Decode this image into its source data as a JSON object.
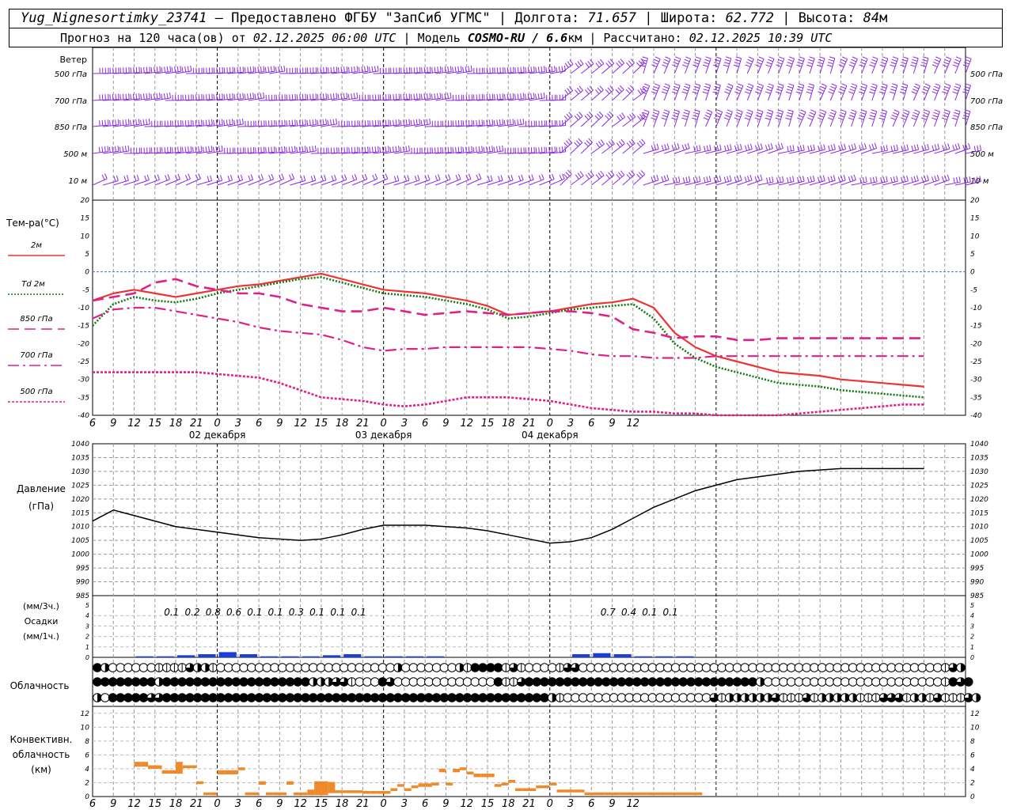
{
  "header": {
    "station": "Yug_Nignesortimky_23741",
    "provider": "Предоставлено ФГБУ \"ЗапСиб УГМС\"",
    "lon_label": "Долгота:",
    "lon_value": "71.657",
    "lat_label": "Широта:",
    "lat_value": "62.772",
    "alt_label": "Высота:",
    "alt_value": "84",
    "alt_unit": "м",
    "forecast_prefix": "Прогноз на 120 часа(ов) от",
    "forecast_from": "02.12.2025 06:00 UTC",
    "model_label": "Модель",
    "model_name": "COSMO-RU / 6.6",
    "model_unit": "км",
    "calc_label": "Рассчитано:",
    "calc_time": "02.12.2025 10:39 UTC"
  },
  "colors": {
    "wind": "#8a2be2",
    "t2m": "#ee3333",
    "td2m": "#117711",
    "t_upper": "#e0208a",
    "pressure": "#000000",
    "precip": "#1a3fd8",
    "convective": "#ee8a2a",
    "zero_line": "#4a6ad8"
  },
  "chart_data": [
    {
      "type": "wind-barbs",
      "name": "wind",
      "title": "Ветер",
      "levels": [
        "500 гПа",
        "700 гПа",
        "850 гПа",
        "500 м",
        "10  м"
      ]
    },
    {
      "type": "line",
      "name": "temperature",
      "ylabel": "Тем-ра(°C)",
      "ylim": [
        -40,
        20
      ],
      "yticks": [
        20,
        15,
        10,
        5,
        0,
        -5,
        -10,
        -15,
        -20,
        -25,
        -30,
        -35,
        -40
      ],
      "x": [
        0,
        3,
        6,
        9,
        12,
        15,
        18,
        21,
        24,
        27,
        30,
        33,
        36,
        39,
        42,
        45,
        48,
        51,
        54,
        57,
        60,
        63,
        66,
        69,
        72,
        75,
        78,
        81,
        84,
        87,
        90,
        93,
        96,
        99,
        102,
        105,
        108,
        111,
        114,
        117,
        120
      ],
      "series": [
        {
          "name": "2м",
          "key": "t2m",
          "values": [
            -8,
            -6,
            -5,
            -6,
            -7,
            -6,
            -5,
            -4,
            -3.5,
            -2.5,
            -1.5,
            -0.5,
            -2,
            -3.5,
            -5,
            -5.5,
            -6,
            -7,
            -8,
            -9.5,
            -12,
            -11.5,
            -11,
            -10,
            -9,
            -8.5,
            -7.5,
            -10,
            -17,
            -21,
            -23.5,
            -25,
            -26.5,
            -28,
            -28.5,
            -29,
            -30,
            -30.5,
            -31,
            -31.5,
            -32
          ]
        },
        {
          "name": "Td  2м",
          "key": "td2m",
          "values": [
            -15,
            -9,
            -7,
            -8,
            -8.5,
            -7.5,
            -6,
            -5,
            -4,
            -3,
            -2,
            -1.5,
            -3,
            -4.5,
            -6,
            -6.5,
            -7,
            -8,
            -9,
            -10.5,
            -13,
            -12.5,
            -11.5,
            -10.5,
            -10,
            -9.5,
            -9,
            -13,
            -20,
            -24,
            -26.5,
            -28,
            -29.5,
            -31,
            -31.5,
            -32,
            -33,
            -33.5,
            -34,
            -34.5,
            -35
          ]
        },
        {
          "name": "850 гПа",
          "key": "t850",
          "values": [
            -8,
            -7,
            -6,
            -3,
            -2,
            -4,
            -5,
            -6,
            -6,
            -7,
            -9,
            -10,
            -11,
            -11,
            -10,
            -11,
            -12,
            -11.5,
            -11,
            -11.5,
            -12,
            -11.5,
            -11,
            -11,
            -11.5,
            -12.5,
            -16,
            -17,
            -18.5,
            -18,
            -18,
            -19,
            -19,
            -18.5,
            -18.5,
            -18.5,
            -18.5,
            -18.5,
            -18.5,
            -18.5,
            -18.5
          ]
        },
        {
          "name": "700 гПа",
          "key": "t700",
          "values": [
            -13,
            -10.5,
            -10,
            -10,
            -11,
            -12,
            -13,
            -14,
            -15.5,
            -16.5,
            -17,
            -17.5,
            -19,
            -21,
            -22,
            -21.5,
            -21.5,
            -21,
            -21,
            -21,
            -21,
            -21,
            -21.5,
            -22,
            -23,
            -23.5,
            -23.5,
            -24,
            -24,
            -24,
            -23.5,
            -23.5,
            -23.5,
            -23.5,
            -23.5,
            -23.5,
            -23.5,
            -23.5,
            -23.5,
            -23.5,
            -23.5
          ]
        },
        {
          "name": "500 гПа",
          "key": "t500",
          "values": [
            -28,
            -28,
            -28,
            -28,
            -28,
            -28,
            -28.5,
            -29,
            -29.5,
            -31,
            -33,
            -35,
            -35.5,
            -36,
            -37,
            -37.5,
            -37,
            -36,
            -35,
            -35,
            -35,
            -35.5,
            -36,
            -37,
            -38,
            -38.5,
            -39,
            -39,
            -39.5,
            -39.5,
            -40,
            -40,
            -40,
            -40,
            -39.5,
            -39,
            -38.5,
            -38,
            -37.5,
            -37,
            -37
          ]
        }
      ]
    },
    {
      "type": "line",
      "name": "pressure",
      "ylabel": "Давление",
      "yunit": "(гПа)",
      "ylim": [
        985,
        1040
      ],
      "yticks": [
        1040,
        1035,
        1030,
        1025,
        1020,
        1015,
        1010,
        1005,
        1000,
        995,
        990,
        985
      ],
      "x": [
        0,
        3,
        6,
        9,
        12,
        15,
        18,
        21,
        24,
        27,
        30,
        33,
        36,
        39,
        42,
        45,
        48,
        51,
        54,
        57,
        60,
        63,
        66,
        69,
        72,
        75,
        78,
        81,
        84,
        87,
        90,
        93,
        96,
        99,
        102,
        105,
        108,
        111,
        114,
        117,
        120
      ],
      "values": [
        1012,
        1016,
        1014,
        1012,
        1010,
        1009,
        1008,
        1007,
        1006,
        1005.5,
        1005,
        1005.5,
        1007,
        1009,
        1010.5,
        1010.5,
        1010.5,
        1010,
        1009.5,
        1008.5,
        1007,
        1005.5,
        1004,
        1004.5,
        1006,
        1009,
        1013,
        1017,
        1020,
        1023,
        1025,
        1027,
        1028,
        1029,
        1030,
        1030.5,
        1031,
        1031,
        1031,
        1031,
        1031
      ]
    },
    {
      "type": "bar",
      "name": "precipitation",
      "ylabel": "Осадки",
      "yunit_3h": "(мм/3ч.)",
      "yunit_1h": "(мм/1ч.)",
      "ylim": [
        0,
        5
      ],
      "yticks": [
        5,
        4,
        3,
        2,
        1,
        0
      ],
      "x": [
        0,
        3,
        6,
        9,
        12,
        15,
        18,
        21,
        24,
        27,
        30,
        33,
        36,
        39,
        42,
        45,
        48,
        51,
        54,
        57,
        60,
        63,
        66,
        69,
        72,
        75,
        78,
        81,
        84,
        87,
        90,
        93,
        96,
        99,
        102,
        105,
        108,
        111,
        114,
        117
      ],
      "values": [
        0,
        0,
        0.1,
        0.1,
        0.2,
        0.3,
        0.5,
        0.3,
        0.1,
        0.1,
        0.1,
        0.2,
        0.3,
        0.1,
        0.1,
        0.1,
        0.1,
        0,
        0,
        0,
        0,
        0,
        0,
        0.3,
        0.4,
        0.3,
        0.1,
        0.1,
        0.1,
        0,
        0,
        0,
        0,
        0,
        0,
        0,
        0,
        0,
        0,
        0
      ],
      "sums": [
        {
          "x": 9,
          "label": "0.1"
        },
        {
          "x": 12,
          "label": "0.2"
        },
        {
          "x": 15,
          "label": "0.8"
        },
        {
          "x": 18,
          "label": "0.6"
        },
        {
          "x": 21,
          "label": "0.1"
        },
        {
          "x": 24,
          "label": "0.1"
        },
        {
          "x": 27,
          "label": "0.3"
        },
        {
          "x": 30,
          "label": "0.1"
        },
        {
          "x": 33,
          "label": "0.1"
        },
        {
          "x": 36,
          "label": "0.1"
        },
        {
          "x": 72,
          "label": "0.7"
        },
        {
          "x": 75,
          "label": "0.4"
        },
        {
          "x": 78,
          "label": "0.1"
        },
        {
          "x": 81,
          "label": "0.1"
        }
      ]
    },
    {
      "type": "table",
      "name": "cloudiness",
      "ylabel": "Облачность",
      "rows": [
        "FHQQQQQQLLLLTHHLQQQQQQQQQQQQQQQQQQQQQQQHQQQQQQQHLFFFFLTLQQQQLTTQQQQQQQQQQQQQQQQQQQQQQQQQQQQQQQQQQQQQQQQQQQQQQQLTH",
        "FFFFFFFFHFFFFFFFFFFFFFFFFFFFHHHTTLQQQFTQQQQQQQQQQQQQFLLTFFFFFFFFFFFFFFFFFFFFFFFFFFFFFFHQQQQQQQQQQQQQQQQQQQQQQQLFTF",
        "HQFFFFFTTFFFFFFFFFFFFFFFFFFFFFFFFFFFFFFFFFFFFFFFFFFFFFFFFFFHLQQQQQQQQQQQQQQQQQQQTLHHHHHHTLLLTLHHHHHLLLTTTLHHLTLLLTH"
      ]
    },
    {
      "type": "bar",
      "name": "convective",
      "ylabel": "Конвективн.",
      "ylabel2": "облачность",
      "yunit": "(км)",
      "ylim": [
        0,
        13
      ],
      "yticks": [
        12,
        10,
        8,
        6,
        4,
        2,
        0
      ],
      "x": [
        6,
        7,
        8,
        9,
        10,
        11,
        12,
        13,
        14,
        15,
        16,
        17,
        18,
        19,
        20,
        21,
        22,
        23,
        24,
        25,
        26,
        27,
        28,
        29,
        30,
        31,
        32,
        33,
        34,
        35,
        36,
        37,
        38,
        39,
        40,
        41,
        42,
        43,
        44,
        45,
        46,
        47,
        48,
        49,
        50,
        51,
        52,
        53,
        54,
        55,
        56,
        57,
        58,
        59,
        60,
        61,
        62,
        63,
        64,
        65,
        66,
        67,
        68,
        69,
        70,
        71,
        72,
        73,
        74,
        75,
        76,
        77,
        78,
        79,
        80,
        81,
        82,
        83,
        84,
        85,
        86,
        87
      ],
      "bottoms": [
        4.3,
        4.3,
        4,
        4,
        3.3,
        3.3,
        3.3,
        4.1,
        4.1,
        1.8,
        0.2,
        0.2,
        3.2,
        3.2,
        3.2,
        3.8,
        0.2,
        0.2,
        1.7,
        0.2,
        0.2,
        0.2,
        1.7,
        0.2,
        0.2,
        0.2,
        0.2,
        0.2,
        0.5,
        0.5,
        0.5,
        0.5,
        0.5,
        0.4,
        0.4,
        0.4,
        0.4,
        0.8,
        1.4,
        0.8,
        1.2,
        1.4,
        1.4,
        1.6,
        3.5,
        1.6,
        3.5,
        3.8,
        3.2,
        2.8,
        2.8,
        2.8,
        1.4,
        1.6,
        2,
        0.8,
        0.8,
        0.8,
        1.2,
        1.2,
        1.6,
        0.6,
        0.6,
        0.6,
        0.6,
        0.2,
        0.2,
        0.2,
        0.2,
        0.2,
        0.2,
        0.2,
        0.2,
        0.2,
        0.2,
        0.2,
        0.2,
        0.2,
        0.2,
        0.2,
        0.2,
        0.2
      ],
      "tops": [
        5,
        5,
        4.5,
        4.5,
        3.8,
        3.8,
        5,
        4.5,
        4.5,
        2.2,
        0.6,
        0.6,
        3.8,
        3.8,
        3.8,
        4.2,
        0.6,
        0.6,
        2.2,
        0.6,
        0.6,
        0.6,
        2.2,
        0.6,
        0.6,
        1,
        2.2,
        2.2,
        2.1,
        0.9,
        0.9,
        0.9,
        0.9,
        0.8,
        0.8,
        0.8,
        0.8,
        1.2,
        1.8,
        1.2,
        1.6,
        1.9,
        1.9,
        2,
        4,
        2,
        4,
        4.2,
        3.6,
        3.3,
        3.3,
        3.3,
        1.8,
        2,
        2.4,
        1.2,
        1.2,
        1.2,
        1.6,
        1.6,
        2,
        1,
        1,
        1,
        1,
        0.6,
        0.6,
        0.6,
        0.6,
        0.6,
        0.6,
        0.6,
        0.6,
        0.6,
        0.6,
        0.6,
        0.6,
        0.6,
        0.6,
        0.6,
        0.6,
        0.6
      ]
    }
  ],
  "x_axis": {
    "tick_labels": [
      "6",
      "9",
      "12",
      "15",
      "18",
      "21",
      "0",
      "3",
      "6",
      "9",
      "12",
      "15",
      "18",
      "21",
      "0",
      "3",
      "6",
      "9",
      "12",
      "15",
      "18",
      "21",
      "0",
      "3",
      "6",
      "9",
      "12"
    ],
    "day_labels": [
      {
        "at_hour": 12,
        "label": "02 декабря"
      },
      {
        "at_hour": 36,
        "label": "03 декабря"
      },
      {
        "at_hour": 60,
        "label": "04 декабря"
      }
    ],
    "midnights": [
      18,
      42,
      66,
      90
    ]
  }
}
